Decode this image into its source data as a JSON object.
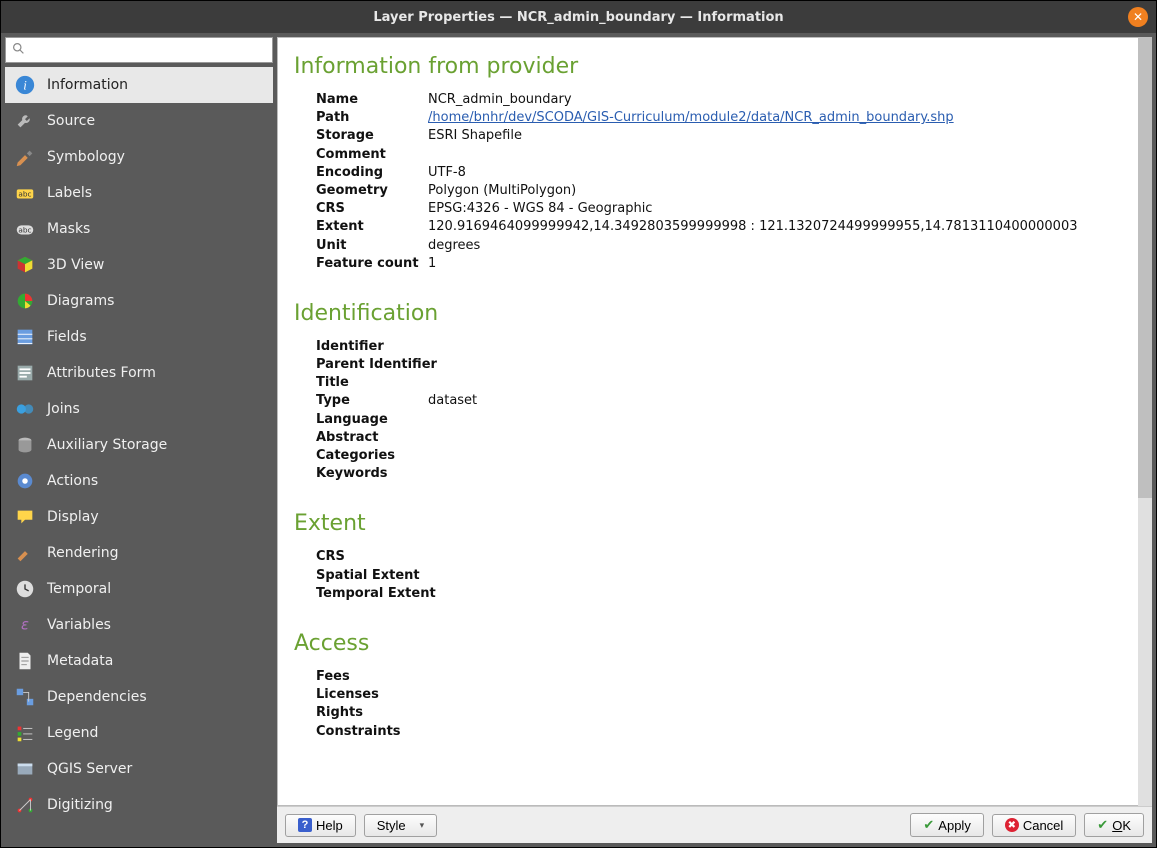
{
  "title": "Layer Properties — NCR_admin_boundary — Information",
  "sidebar": {
    "items": [
      {
        "label": "Information"
      },
      {
        "label": "Source"
      },
      {
        "label": "Symbology"
      },
      {
        "label": "Labels"
      },
      {
        "label": "Masks"
      },
      {
        "label": "3D View"
      },
      {
        "label": "Diagrams"
      },
      {
        "label": "Fields"
      },
      {
        "label": "Attributes Form"
      },
      {
        "label": "Joins"
      },
      {
        "label": "Auxiliary Storage"
      },
      {
        "label": "Actions"
      },
      {
        "label": "Display"
      },
      {
        "label": "Rendering"
      },
      {
        "label": "Temporal"
      },
      {
        "label": "Variables"
      },
      {
        "label": "Metadata"
      },
      {
        "label": "Dependencies"
      },
      {
        "label": "Legend"
      },
      {
        "label": "QGIS Server"
      },
      {
        "label": "Digitizing"
      }
    ]
  },
  "sections": {
    "provider": {
      "heading": "Information from provider",
      "rows": {
        "name_k": "Name",
        "name_v": "NCR_admin_boundary",
        "path_k": "Path",
        "path_v": "/home/bnhr/dev/SCODA/GIS-Curriculum/module2/data/NCR_admin_boundary.shp",
        "storage_k": "Storage",
        "storage_v": "ESRI Shapefile",
        "comment_k": "Comment",
        "comment_v": "",
        "encoding_k": "Encoding",
        "encoding_v": "UTF-8",
        "geometry_k": "Geometry",
        "geometry_v": "Polygon (MultiPolygon)",
        "crs_k": "CRS",
        "crs_v": "EPSG:4326 - WGS 84 - Geographic",
        "extent_k": "Extent",
        "extent_v": "120.9169464099999942,14.3492803599999998 : 121.1320724499999955,14.7813110400000003",
        "unit_k": "Unit",
        "unit_v": "degrees",
        "fc_k": "Feature count",
        "fc_v": "1"
      }
    },
    "identification": {
      "heading": "Identification",
      "rows": {
        "identifier_k": "Identifier",
        "identifier_v": "",
        "pidentifier_k": "Parent Identifier",
        "pidentifier_v": "",
        "title_k": "Title",
        "title_v": "",
        "type_k": "Type",
        "type_v": "dataset",
        "language_k": "Language",
        "language_v": "",
        "abstract_k": "Abstract",
        "abstract_v": "",
        "categories_k": "Categories",
        "categories_v": "",
        "keywords_k": "Keywords",
        "keywords_v": ""
      }
    },
    "extent": {
      "heading": "Extent",
      "rows": {
        "crs_k": "CRS",
        "crs_v": "",
        "spatial_k": "Spatial Extent",
        "spatial_v": "",
        "temporal_k": "Temporal Extent",
        "temporal_v": ""
      }
    },
    "access": {
      "heading": "Access",
      "rows": {
        "fees_k": "Fees",
        "fees_v": "",
        "licenses_k": "Licenses",
        "licenses_v": "",
        "rights_k": "Rights",
        "rights_v": "",
        "constraints_k": "Constraints",
        "constraints_v": ""
      }
    }
  },
  "footer": {
    "help": "Help",
    "style": "Style",
    "apply": "Apply",
    "cancel": "Cancel",
    "ok": "OK"
  }
}
